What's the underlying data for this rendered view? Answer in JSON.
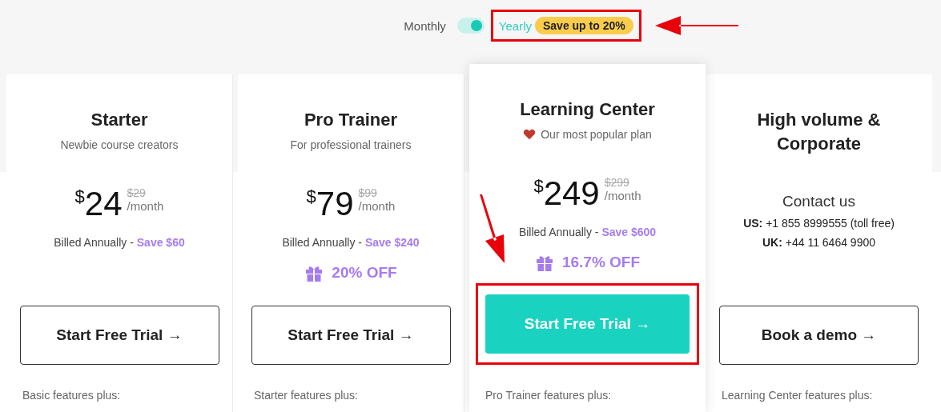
{
  "billing_toggle": {
    "monthly_label": "Monthly",
    "yearly_label": "Yearly",
    "on": true,
    "badge": "Save up to 20%"
  },
  "plans": [
    {
      "kind": "price",
      "featured": false,
      "name": "Starter",
      "subtitle": "Newbie course creators",
      "currency": "$",
      "price": "24",
      "old_price": "$29",
      "period": "/month",
      "billed": "Billed Annually - ",
      "save": "Save $60",
      "button": "Start Free Trial →",
      "features_intro": "Basic features plus:"
    },
    {
      "kind": "price",
      "featured": false,
      "name": "Pro Trainer",
      "subtitle": "For professional trainers",
      "currency": "$",
      "price": "79",
      "old_price": "$99",
      "period": "/month",
      "billed": "Billed Annually - ",
      "save": "Save $240",
      "discount": "20% OFF",
      "button": "Start Free Trial →",
      "features_intro": "Starter features plus:"
    },
    {
      "kind": "price",
      "featured": true,
      "name": "Learning Center",
      "popular": "Our most popular plan",
      "currency": "$",
      "price": "249",
      "old_price": "$299",
      "period": "/month",
      "billed": "Billed Annually - ",
      "save": "Save $600",
      "discount": "16.7% OFF",
      "button": "Start Free Trial →",
      "features_intro": "Pro Trainer features plus:"
    },
    {
      "kind": "contact",
      "featured": false,
      "name": "High volume & Corporate",
      "contact": "Contact us",
      "phones": [
        {
          "label": "US:",
          "number": " +1 855 8999555 (toll free)"
        },
        {
          "label": "UK:",
          "number": " +44 11 6464 9900"
        }
      ],
      "button": "Book a demo →",
      "features_intro": "Learning Center features plus:"
    }
  ]
}
